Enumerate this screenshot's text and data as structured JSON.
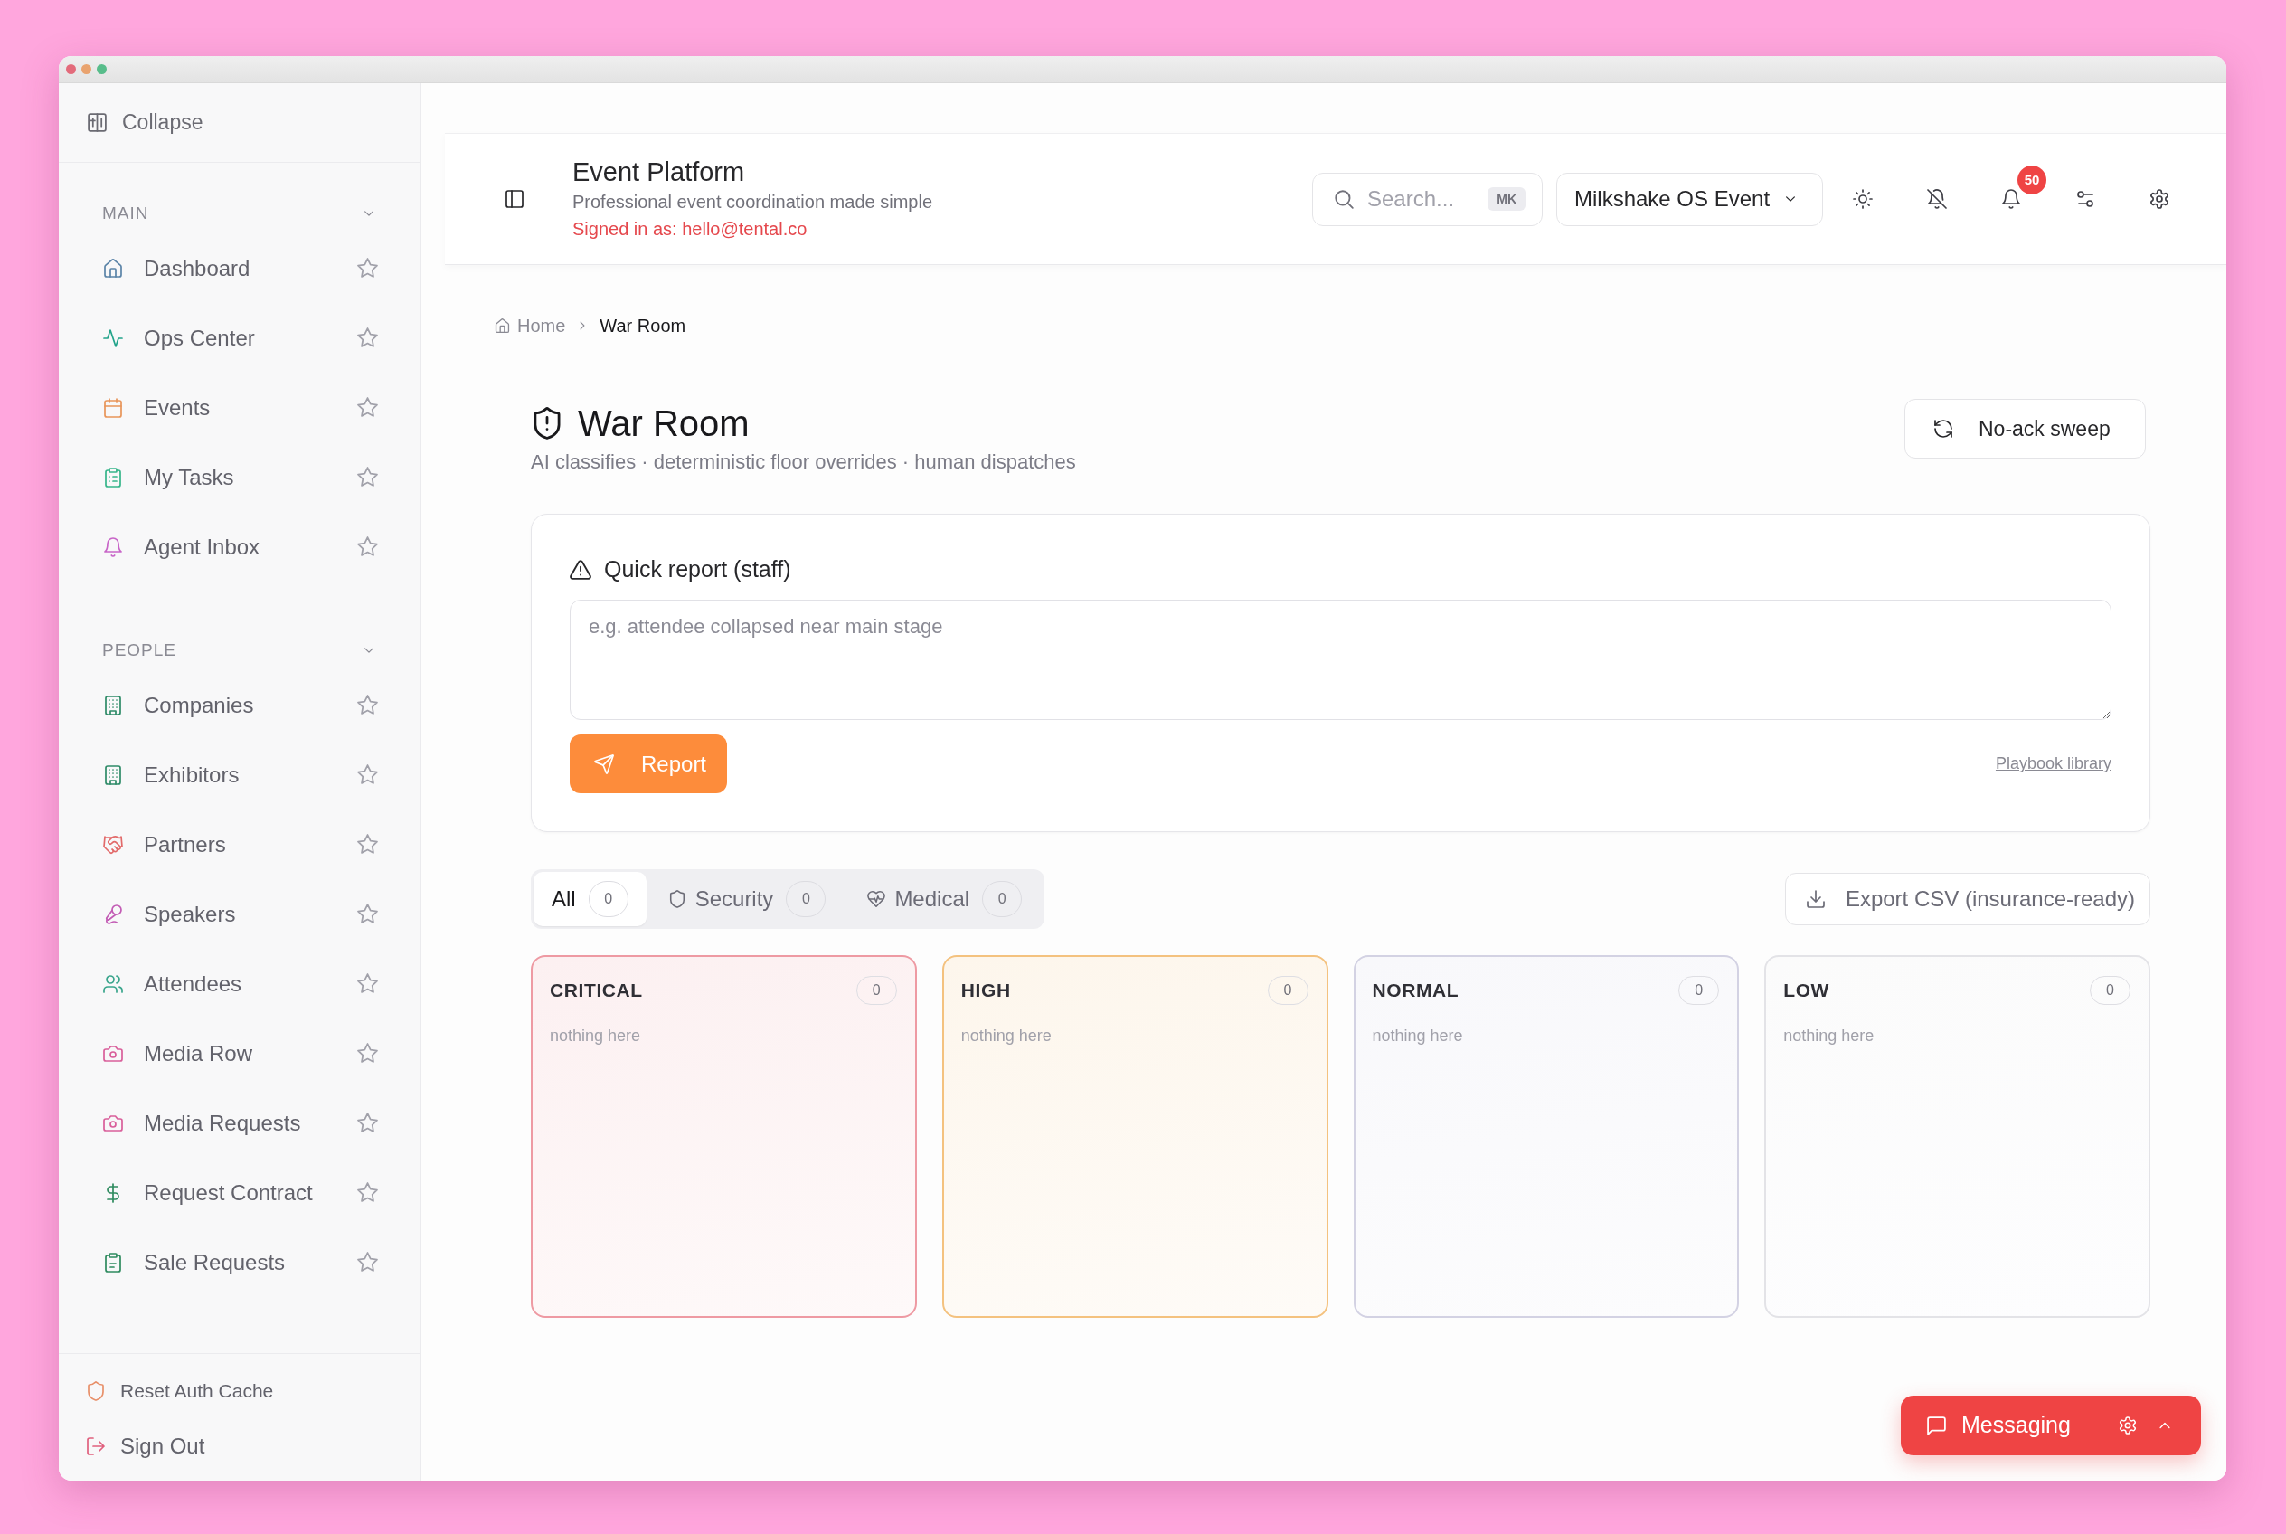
{
  "sidebar": {
    "collapse_label": "Collapse",
    "sections": [
      {
        "title": "MAIN",
        "expanded": true,
        "items": [
          {
            "label": "Dashboard",
            "selected": false,
            "starred": false
          },
          {
            "label": "Ops Center",
            "selected": false,
            "starred": false
          },
          {
            "label": "Events",
            "selected": false,
            "starred": false
          },
          {
            "label": "My Tasks",
            "selected": false,
            "starred": false
          },
          {
            "label": "Agent Inbox",
            "selected": false,
            "starred": false
          }
        ]
      },
      {
        "title": "PEOPLE",
        "expanded": true,
        "items": [
          {
            "label": "Companies",
            "selected": false,
            "starred": false
          },
          {
            "label": "Exhibitors",
            "selected": false,
            "starred": false
          },
          {
            "label": "Partners",
            "selected": false,
            "starred": false
          },
          {
            "label": "Speakers",
            "selected": false,
            "starred": false
          },
          {
            "label": "Attendees",
            "selected": false,
            "starred": false
          },
          {
            "label": "Media Row",
            "selected": false,
            "starred": false
          },
          {
            "label": "Media Requests",
            "selected": false,
            "starred": false
          },
          {
            "label": "Request Contract",
            "selected": false,
            "starred": false
          },
          {
            "label": "Sale Requests",
            "selected": false,
            "starred": false
          }
        ]
      }
    ],
    "footer": [
      {
        "label": "Reset Auth Cache"
      },
      {
        "label": "Sign Out"
      }
    ]
  },
  "header": {
    "title": "Event Platform",
    "subtitle": "Professional event coordination made simple",
    "signed_in": "Signed in as: hello@tental.co",
    "search": {
      "placeholder": "Search...",
      "shortcut": "MK"
    },
    "event_select": {
      "value": "Milkshake OS Event"
    },
    "notifications": {
      "count": "50"
    }
  },
  "breadcrumb": [
    {
      "label": "Home",
      "current": false
    },
    {
      "label": "War Room",
      "current": true
    }
  ],
  "page": {
    "title": "War Room",
    "subtitle": "AI classifies · deterministic floor overrides · human dispatches",
    "action": "No-ack sweep"
  },
  "quick_report": {
    "title": "Quick report (staff)",
    "placeholder": "e.g. attendee collapsed near main stage",
    "submit": "Report",
    "link": "Playbook library"
  },
  "filters": {
    "tabs": [
      {
        "label": "All",
        "count": "0",
        "selected": true
      },
      {
        "label": "Security",
        "count": "0",
        "selected": false
      },
      {
        "label": "Medical",
        "count": "0",
        "selected": false
      }
    ],
    "export": "Export CSV (insurance-ready)"
  },
  "lanes": [
    {
      "title": "CRITICAL",
      "count": "0",
      "empty_text": "nothing here",
      "color": "#ee9aa3"
    },
    {
      "title": "HIGH",
      "count": "0",
      "empty_text": "nothing here",
      "color": "#f4c27f"
    },
    {
      "title": "NORMAL",
      "count": "0",
      "empty_text": "nothing here",
      "color": "#d3d2e3"
    },
    {
      "title": "LOW",
      "count": "0",
      "empty_text": "nothing here",
      "color": "#e3e3e7"
    }
  ],
  "messaging": {
    "label": "Messaging",
    "expanded": false
  }
}
